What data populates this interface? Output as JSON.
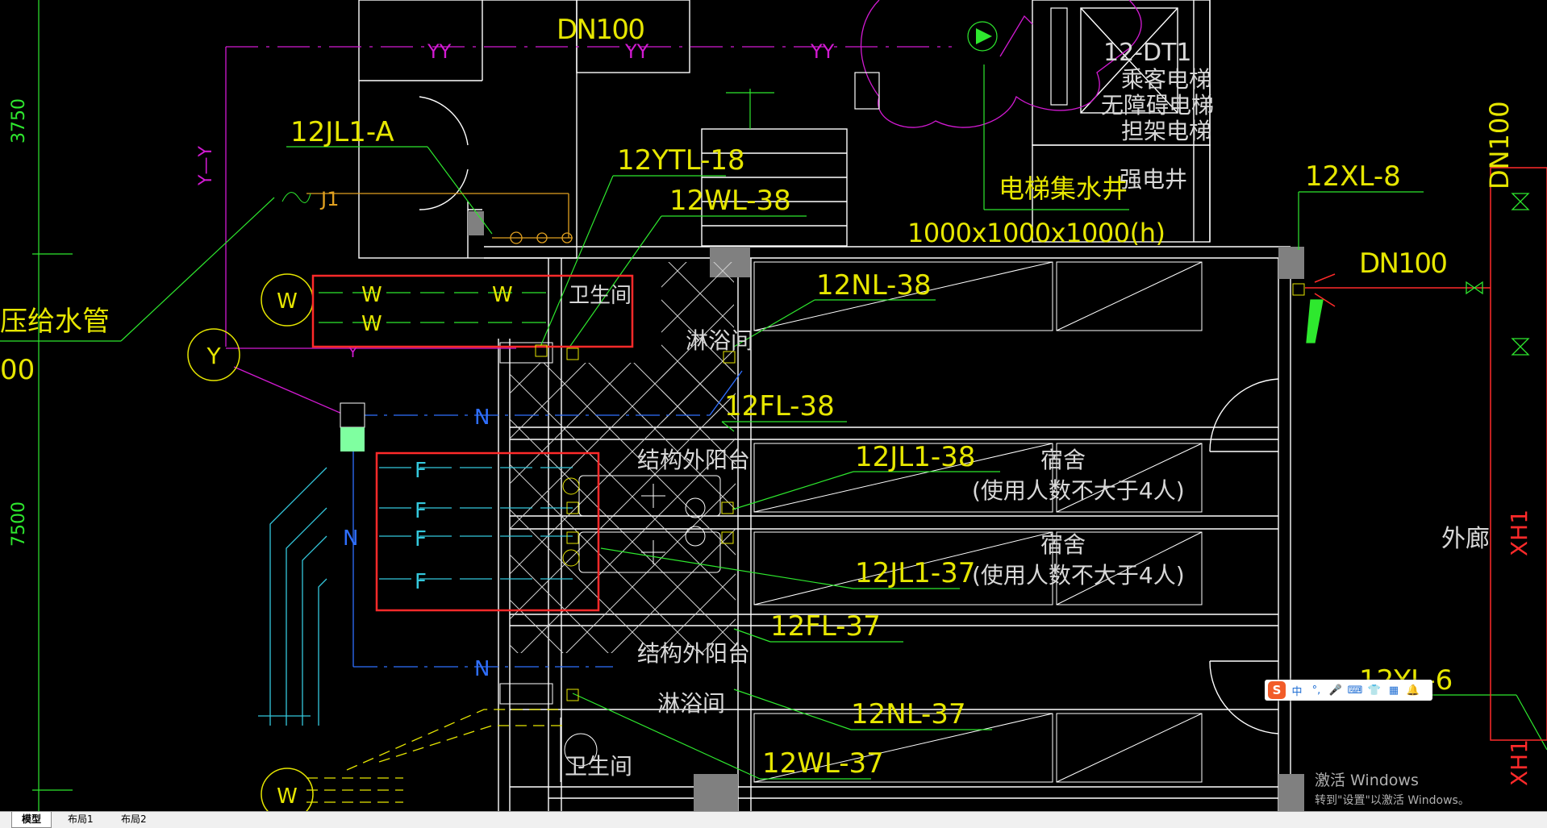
{
  "colors": {
    "background": "#000000",
    "wall": "#ffffff",
    "text_yellow": "#e6e600",
    "leader_green": "#2ee82e",
    "pipe_blue": "#2f6fff",
    "pipe_cyan": "#34c8dc",
    "pipe_magenta": "#d21ad2",
    "red_box": "#ff2a2a",
    "hatch": "#d8d8d8"
  },
  "dimensions": [
    "3750",
    "7500"
  ],
  "pipe_labels": {
    "dn100_top": "DN100",
    "dn100_right": "DN100",
    "dn100_vertical": "DN100",
    "yy1": "YY",
    "yy2": "YY",
    "yy3": "YY",
    "j1": "J1",
    "left_pipe": "压给水管",
    "left_00": "00"
  },
  "riser_tags": {
    "jl1_a": "12JL1-A",
    "ytl_18": "12YTL-18",
    "wl_38": "12WL-38",
    "nl_38": "12NL-38",
    "fl_38": "12FL-38",
    "jl1_38": "12JL1-38",
    "jl1_37": "12JL1-37",
    "fl_37": "12FL-37",
    "nl_37": "12NL-37",
    "wl_37": "12WL-37",
    "xl_8": "12XL-8",
    "yl_6": "12YL-6"
  },
  "elevator": {
    "dt": "12-DT1",
    "line1": "乘客电梯",
    "line2": "无障碍电梯",
    "line3": "担架电梯",
    "sump": "电梯集水井",
    "sump_size": "1000x1000x1000(h)",
    "strong_well": "强电井"
  },
  "room_labels": {
    "toilet_top": "卫生间",
    "shower_top": "淋浴间",
    "balcony_top": "结构外阳台",
    "dorm1_title": "宿舍",
    "dorm1_sub": "(使用人数不大于4人)",
    "dorm2_title": "宿舍",
    "dorm2_sub": "(使用人数不大于4人)",
    "balcony_bottom": "结构外阳台",
    "shower_bottom": "淋浴间",
    "toilet_bottom": "卫生间",
    "corridor": "外廊",
    "xh1_top": "XH1",
    "xh1_bottom": "XH1"
  },
  "circle_tags": {
    "w_top": "W",
    "y": "Y",
    "w_bottom": "W"
  },
  "pipe_letters": {
    "w": "W",
    "f": "F",
    "n": "N"
  },
  "layout_tabs": [
    {
      "label": "模型",
      "active": true
    },
    {
      "label": "布局1",
      "active": false
    },
    {
      "label": "布局2",
      "active": false
    }
  ],
  "ime_toolbar": {
    "logo": "S",
    "mode": "中",
    "punct": "°,",
    "mic": "🎤",
    "keyboard": "⌨",
    "skin": "👕",
    "apps": "▦",
    "more": "🔔"
  },
  "activation": {
    "title": "激活 Windows",
    "subtitle": "转到\"设置\"以激活 Windows。"
  }
}
